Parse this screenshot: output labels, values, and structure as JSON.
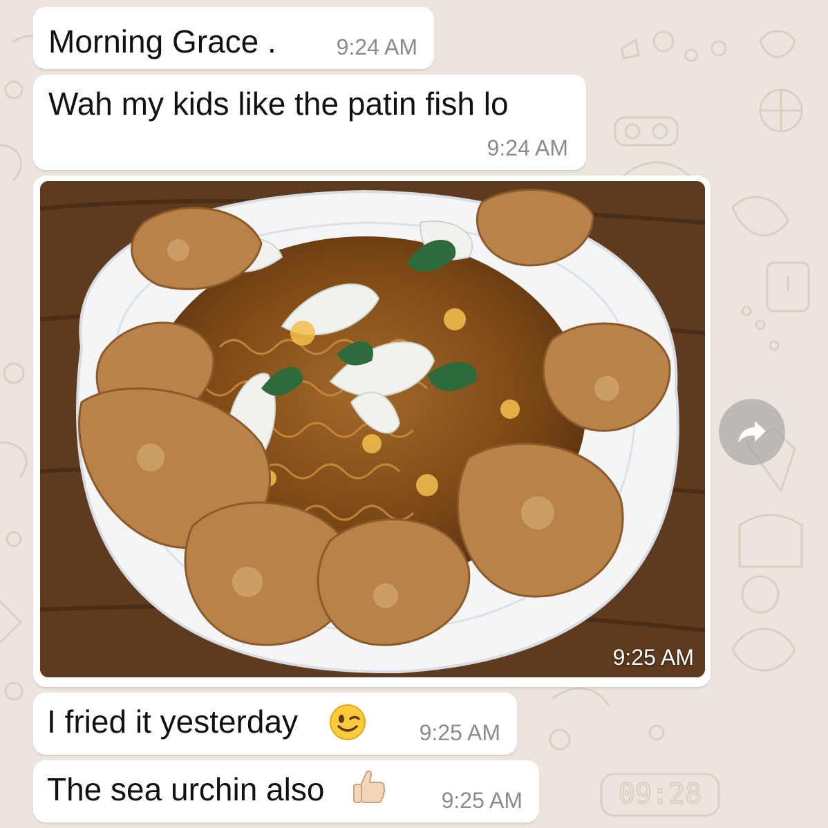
{
  "theme": {
    "background": "#ece5dd",
    "bubble": "#ffffff",
    "time_color": "#8b8b8b"
  },
  "messages": [
    {
      "text": "Morning Grace .",
      "time": "9:24 AM"
    },
    {
      "text": "Wah my kids like the patin fish lo",
      "time": "9:24 AM"
    },
    {
      "type": "image",
      "image_icon": "photo-of-fried-noodles-with-fried-fish",
      "time": "9:25 AM"
    },
    {
      "text": "I fried it yesterday",
      "emoji_icon": "winking-face-icon",
      "time": "9:25 AM"
    },
    {
      "text": "The sea urchin also",
      "emoji_icon": "thumbs-up-icon",
      "time": "9:25 AM"
    }
  ],
  "forward_button": {
    "icon": "forward-arrow-icon"
  },
  "wallpaper_clock": "09:28"
}
